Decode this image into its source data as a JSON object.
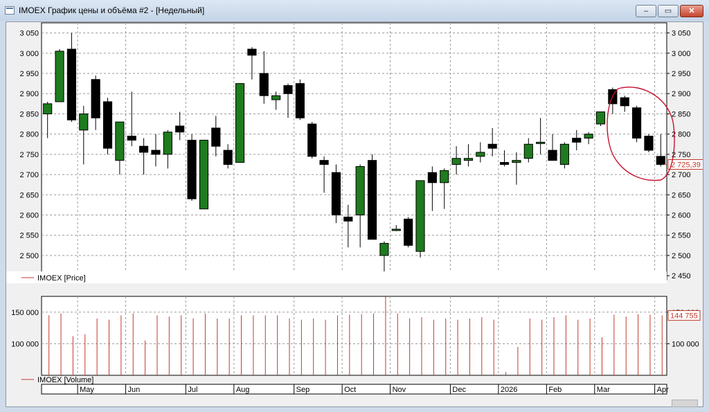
{
  "window": {
    "title": "IMOEX График цены и объёма #2 - [Недельный]",
    "minimize_glyph": "–",
    "restore_glyph": "▭",
    "close_glyph": "✕"
  },
  "chart_data": [
    {
      "type": "candlestick",
      "legend": "IMOEX [Price]",
      "last_value_label": "2 725,39",
      "ylim": [
        2440,
        3075
      ],
      "yticks": [
        2450,
        2500,
        2550,
        2600,
        2650,
        2700,
        2750,
        2800,
        2850,
        2900,
        2950,
        3000,
        3050
      ],
      "ytick_labels": [
        "2 450",
        "2 500",
        "2 550",
        "2 600",
        "2 650",
        "2 700",
        "2 750",
        "2 800",
        "2 850",
        "2 900",
        "2 950",
        "3 000",
        "3 050"
      ],
      "grid": true,
      "up_color": "#1e7b1e",
      "down_color": "#000000",
      "candles": [
        {
          "o": 2850,
          "h": 2880,
          "l": 2790,
          "c": 2875
        },
        {
          "o": 2880,
          "h": 3010,
          "l": 2880,
          "c": 3005
        },
        {
          "o": 3010,
          "h": 3050,
          "l": 2830,
          "c": 2835
        },
        {
          "o": 2810,
          "h": 2870,
          "l": 2725,
          "c": 2850
        },
        {
          "o": 2935,
          "h": 2945,
          "l": 2810,
          "c": 2840
        },
        {
          "o": 2880,
          "h": 2890,
          "l": 2750,
          "c": 2765
        },
        {
          "o": 2735,
          "h": 2830,
          "l": 2700,
          "c": 2830
        },
        {
          "o": 2795,
          "h": 2905,
          "l": 2770,
          "c": 2785
        },
        {
          "o": 2770,
          "h": 2790,
          "l": 2700,
          "c": 2755
        },
        {
          "o": 2760,
          "h": 2800,
          "l": 2720,
          "c": 2750
        },
        {
          "o": 2750,
          "h": 2810,
          "l": 2715,
          "c": 2805
        },
        {
          "o": 2820,
          "h": 2855,
          "l": 2785,
          "c": 2805
        },
        {
          "o": 2785,
          "h": 2800,
          "l": 2635,
          "c": 2640
        },
        {
          "o": 2615,
          "h": 2785,
          "l": 2615,
          "c": 2785
        },
        {
          "o": 2815,
          "h": 2845,
          "l": 2745,
          "c": 2770
        },
        {
          "o": 2760,
          "h": 2775,
          "l": 2715,
          "c": 2725
        },
        {
          "o": 2730,
          "h": 2925,
          "l": 2730,
          "c": 2925
        },
        {
          "o": 3010,
          "h": 3015,
          "l": 2935,
          "c": 2995
        },
        {
          "o": 2950,
          "h": 3005,
          "l": 2875,
          "c": 2895
        },
        {
          "o": 2885,
          "h": 2905,
          "l": 2860,
          "c": 2895
        },
        {
          "o": 2920,
          "h": 2925,
          "l": 2840,
          "c": 2900
        },
        {
          "o": 2925,
          "h": 2935,
          "l": 2835,
          "c": 2840
        },
        {
          "o": 2825,
          "h": 2830,
          "l": 2740,
          "c": 2745
        },
        {
          "o": 2735,
          "h": 2745,
          "l": 2655,
          "c": 2725
        },
        {
          "o": 2705,
          "h": 2725,
          "l": 2580,
          "c": 2600
        },
        {
          "o": 2595,
          "h": 2625,
          "l": 2520,
          "c": 2585
        },
        {
          "o": 2600,
          "h": 2725,
          "l": 2520,
          "c": 2720
        },
        {
          "o": 2735,
          "h": 2750,
          "l": 2540,
          "c": 2540
        },
        {
          "o": 2500,
          "h": 2535,
          "l": 2460,
          "c": 2530
        },
        {
          "o": 2565,
          "h": 2575,
          "l": 2560,
          "c": 2565
        },
        {
          "o": 2590,
          "h": 2595,
          "l": 2520,
          "c": 2525
        },
        {
          "o": 2510,
          "h": 2685,
          "l": 2495,
          "c": 2685
        },
        {
          "o": 2705,
          "h": 2720,
          "l": 2610,
          "c": 2680
        },
        {
          "o": 2680,
          "h": 2715,
          "l": 2615,
          "c": 2710
        },
        {
          "o": 2725,
          "h": 2770,
          "l": 2700,
          "c": 2740
        },
        {
          "o": 2735,
          "h": 2775,
          "l": 2720,
          "c": 2740
        },
        {
          "o": 2745,
          "h": 2780,
          "l": 2730,
          "c": 2755
        },
        {
          "o": 2775,
          "h": 2815,
          "l": 2745,
          "c": 2765
        },
        {
          "o": 2730,
          "h": 2760,
          "l": 2720,
          "c": 2725
        },
        {
          "o": 2730,
          "h": 2755,
          "l": 2675,
          "c": 2735
        },
        {
          "o": 2740,
          "h": 2790,
          "l": 2730,
          "c": 2775
        },
        {
          "o": 2780,
          "h": 2840,
          "l": 2750,
          "c": 2780
        },
        {
          "o": 2760,
          "h": 2800,
          "l": 2735,
          "c": 2735
        },
        {
          "o": 2725,
          "h": 2780,
          "l": 2715,
          "c": 2775
        },
        {
          "o": 2790,
          "h": 2810,
          "l": 2760,
          "c": 2780
        },
        {
          "o": 2790,
          "h": 2805,
          "l": 2775,
          "c": 2800
        },
        {
          "o": 2825,
          "h": 2855,
          "l": 2820,
          "c": 2855
        },
        {
          "o": 2910,
          "h": 2915,
          "l": 2850,
          "c": 2875
        },
        {
          "o": 2890,
          "h": 2895,
          "l": 2855,
          "c": 2870
        },
        {
          "o": 2865,
          "h": 2870,
          "l": 2780,
          "c": 2790
        },
        {
          "o": 2795,
          "h": 2800,
          "l": 2755,
          "c": 2760
        },
        {
          "o": 2745,
          "h": 2800,
          "l": 2720,
          "c": 2725
        }
      ]
    },
    {
      "type": "bar",
      "legend": "IMOEX [Volume]",
      "last_value_label": "144 755",
      "ylim": [
        50000,
        175000
      ],
      "yticks": [
        100000,
        150000
      ],
      "ytick_labels": [
        "100 000",
        "150 000"
      ],
      "color": "#c0392b",
      "values": [
        145000,
        148000,
        112000,
        115000,
        140000,
        138000,
        145000,
        148000,
        105000,
        145000,
        143000,
        145000,
        140000,
        148000,
        140000,
        140000,
        145000,
        145000,
        145000,
        145000,
        140000,
        138000,
        140000,
        138000,
        145000,
        146000,
        147000,
        148000,
        175000,
        148000,
        140000,
        142000,
        138000,
        140000,
        138000,
        140000,
        142000,
        138000,
        55000,
        95000,
        140000,
        138000,
        142000,
        145000,
        138000,
        140000,
        110000,
        146000,
        143000,
        147000,
        146000,
        144755
      ]
    }
  ],
  "time_axis": {
    "labels": [
      {
        "i": 3,
        "text": "May"
      },
      {
        "i": 7,
        "text": "Jun"
      },
      {
        "i": 12,
        "text": "Jul"
      },
      {
        "i": 16,
        "text": "Aug"
      },
      {
        "i": 21,
        "text": "Sep"
      },
      {
        "i": 25,
        "text": "Oct"
      },
      {
        "i": 29,
        "text": "Nov"
      },
      {
        "i": 34,
        "text": "Dec"
      },
      {
        "i": 38,
        "text": "2026"
      },
      {
        "i": 42,
        "text": "Feb"
      },
      {
        "i": 46,
        "text": "Mar"
      },
      {
        "i": 51,
        "text": "Apr"
      }
    ]
  }
}
